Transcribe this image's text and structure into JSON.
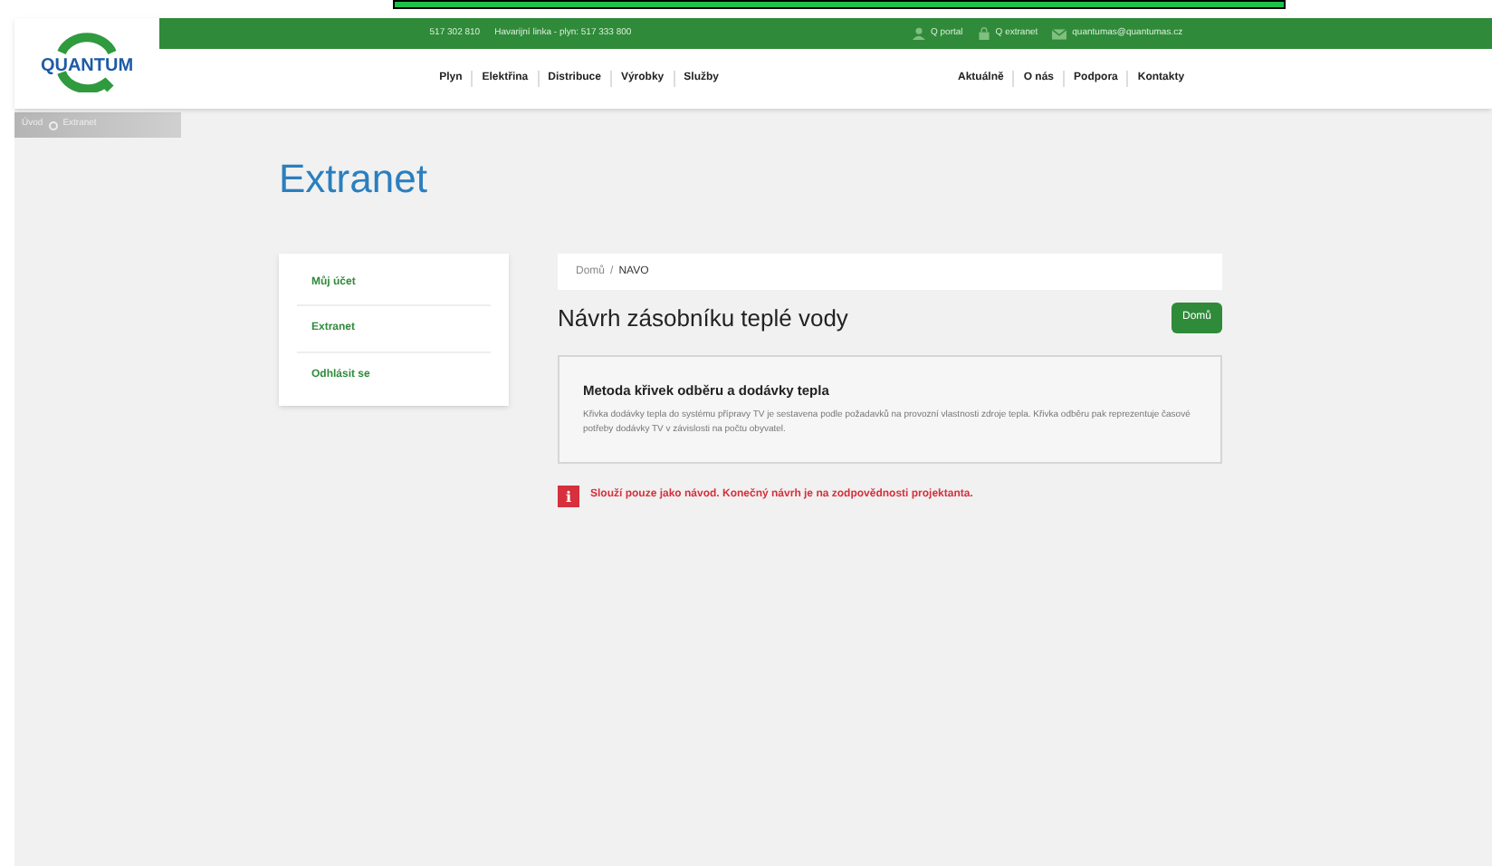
{
  "topbar": {
    "phone": "517 302 810",
    "emergency": "Havarijní linka - plyn: 517 333 800",
    "links": [
      {
        "kind": "user",
        "label": "Q portal"
      },
      {
        "kind": "lock",
        "label": "Q extranet"
      },
      {
        "kind": "mail",
        "label": "quantumas@quantumas.cz"
      }
    ]
  },
  "logo": {
    "text": "QUANTUM"
  },
  "nav_left": [
    "Plyn",
    "Elektřina",
    "Distribuce",
    "Výrobky",
    "Služby"
  ],
  "nav_right": [
    "Aktuálně",
    "O nás",
    "Podpora",
    "Kontakty"
  ],
  "breadcrumb_tab": {
    "home": "Úvod",
    "current": "Extranet"
  },
  "page_title": "Extranet",
  "sidebar": {
    "items": [
      "Můj účet",
      "Extranet",
      "Odhlásit se"
    ]
  },
  "breadcrumb": {
    "home": "Domů",
    "separator": "/",
    "current": "NAVO"
  },
  "heading": "Návrh zásobníku teplé vody",
  "home_button": "Domů",
  "card": {
    "title": "Metoda křivek odběru a dodávky tepla",
    "text": "Křivka dodávky tepla do systému přípravy TV je sestavena podle požadavků na provozní vlastnosti zdroje tepla. Křivka odběru pak reprezentuje časové potřeby dodávky TV v závislosti na počtu obyvatel."
  },
  "warning": {
    "icon": "i",
    "text": "Slouží pouze jako návod. Konečný návrh je na zodpovědnosti projektanta."
  }
}
